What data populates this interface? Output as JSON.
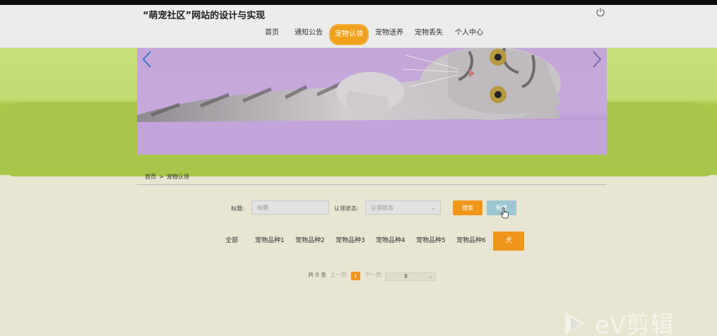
{
  "header": {
    "title": "“萌宠社区”网站的设计与实现",
    "nav": [
      "首页",
      "通知公告",
      "宠物认领",
      "宠物送养",
      "宠物丢失",
      "个人中心"
    ],
    "active_nav": "宠物认领",
    "power_icon": "power-icon"
  },
  "banner": {
    "image": "gray-tabby-cat-lying-on-purple-background",
    "prev_icon": "chevron-left-icon",
    "next_icon": "chevron-right-icon"
  },
  "breadcrumb": {
    "home": "首页",
    "separator": ">",
    "current": "宠物认领"
  },
  "search": {
    "title_label": "标题:",
    "title_placeholder": "标题",
    "status_label": "认领状态:",
    "status_placeholder": "认领状态",
    "search_button": "搜索",
    "add_button": "新增"
  },
  "categories": {
    "items": [
      "全部",
      "宠物品种1",
      "宠物品种2",
      "宠物品种3",
      "宠物品种4",
      "宠物品种5",
      "宠物品种6",
      "犬"
    ],
    "active": "犬"
  },
  "pagination": {
    "total": "共 0 条",
    "prev": "上一页",
    "current_page": "1",
    "next": "下一页",
    "page_size": "8"
  },
  "watermark": {
    "text": "eV剪辑"
  },
  "colors": {
    "accent": "#f0961b",
    "add_button": "#9cc7d1",
    "band_green": "#a8c649",
    "background": "#e8e5d2"
  }
}
